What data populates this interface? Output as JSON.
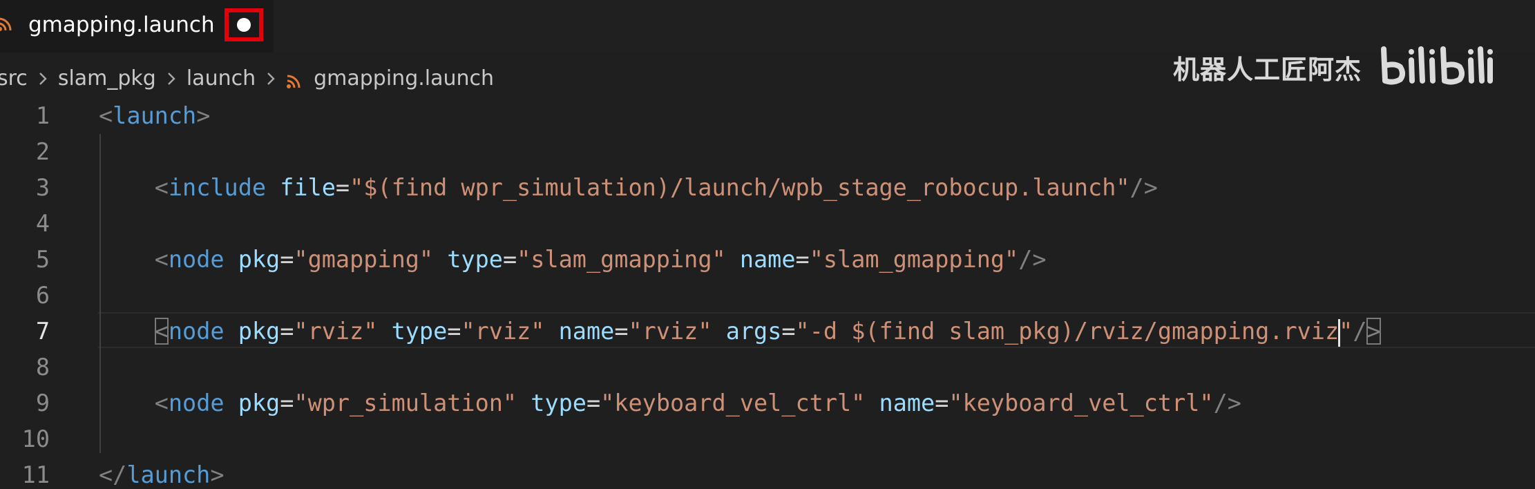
{
  "tab": {
    "title": "gmapping.launch",
    "file_icon": "rss-icon",
    "unsaved_indicator": "dot-icon",
    "highlight_color": "#e3000b"
  },
  "breadcrumb": {
    "items": [
      "src",
      "slam_pkg",
      "launch"
    ],
    "file": "gmapping.launch",
    "separator_icon": "chevron-right-icon"
  },
  "watermark": {
    "author": "机器人工匠阿杰",
    "logo_text": "bilibili"
  },
  "editor": {
    "active_line": 7,
    "lines": [
      {
        "number": "1",
        "tokens": [
          {
            "t": "<",
            "c": "punct"
          },
          {
            "t": "launch",
            "c": "tag"
          },
          {
            "t": ">",
            "c": "punct"
          }
        ]
      },
      {
        "number": "2",
        "tokens": []
      },
      {
        "number": "3",
        "tokens": [
          {
            "t": "    ",
            "c": "eq"
          },
          {
            "t": "<",
            "c": "punct"
          },
          {
            "t": "include",
            "c": "tag"
          },
          {
            "t": " ",
            "c": "eq"
          },
          {
            "t": "file",
            "c": "attr"
          },
          {
            "t": "=",
            "c": "eq"
          },
          {
            "t": "\"$(find wpr_simulation)/launch/wpb_stage_robocup.launch\"",
            "c": "str"
          },
          {
            "t": "/>",
            "c": "punct"
          }
        ]
      },
      {
        "number": "4",
        "tokens": []
      },
      {
        "number": "5",
        "tokens": [
          {
            "t": "    ",
            "c": "eq"
          },
          {
            "t": "<",
            "c": "punct"
          },
          {
            "t": "node",
            "c": "tag"
          },
          {
            "t": " ",
            "c": "eq"
          },
          {
            "t": "pkg",
            "c": "attr"
          },
          {
            "t": "=",
            "c": "eq"
          },
          {
            "t": "\"gmapping\"",
            "c": "str"
          },
          {
            "t": " ",
            "c": "eq"
          },
          {
            "t": "type",
            "c": "attr"
          },
          {
            "t": "=",
            "c": "eq"
          },
          {
            "t": "\"slam_gmapping\"",
            "c": "str"
          },
          {
            "t": " ",
            "c": "eq"
          },
          {
            "t": "name",
            "c": "attr"
          },
          {
            "t": "=",
            "c": "eq"
          },
          {
            "t": "\"slam_gmapping\"",
            "c": "str"
          },
          {
            "t": "/>",
            "c": "punct"
          }
        ]
      },
      {
        "number": "6",
        "tokens": []
      },
      {
        "number": "7",
        "tokens": [
          {
            "t": "    ",
            "c": "eq"
          },
          {
            "t": "<",
            "c": "punct",
            "match": true
          },
          {
            "t": "node",
            "c": "tag"
          },
          {
            "t": " ",
            "c": "eq"
          },
          {
            "t": "pkg",
            "c": "attr"
          },
          {
            "t": "=",
            "c": "eq"
          },
          {
            "t": "\"rviz\"",
            "c": "str"
          },
          {
            "t": " ",
            "c": "eq"
          },
          {
            "t": "type",
            "c": "attr"
          },
          {
            "t": "=",
            "c": "eq"
          },
          {
            "t": "\"rviz\"",
            "c": "str"
          },
          {
            "t": " ",
            "c": "eq"
          },
          {
            "t": "name",
            "c": "attr"
          },
          {
            "t": "=",
            "c": "eq"
          },
          {
            "t": "\"rviz\"",
            "c": "str"
          },
          {
            "t": " ",
            "c": "eq"
          },
          {
            "t": "args",
            "c": "attr"
          },
          {
            "t": "=",
            "c": "eq"
          },
          {
            "t": "\"-d $(find slam_pkg)/rviz/gmapping.rviz",
            "c": "str"
          },
          {
            "t": "",
            "c": "cursor"
          },
          {
            "t": "\"",
            "c": "str"
          },
          {
            "t": "/",
            "c": "punct"
          },
          {
            "t": ">",
            "c": "punct",
            "match": true
          }
        ]
      },
      {
        "number": "8",
        "tokens": []
      },
      {
        "number": "9",
        "tokens": [
          {
            "t": "    ",
            "c": "eq"
          },
          {
            "t": "<",
            "c": "punct"
          },
          {
            "t": "node",
            "c": "tag"
          },
          {
            "t": " ",
            "c": "eq"
          },
          {
            "t": "pkg",
            "c": "attr"
          },
          {
            "t": "=",
            "c": "eq"
          },
          {
            "t": "\"wpr_simulation\"",
            "c": "str"
          },
          {
            "t": " ",
            "c": "eq"
          },
          {
            "t": "type",
            "c": "attr"
          },
          {
            "t": "=",
            "c": "eq"
          },
          {
            "t": "\"keyboard_vel_ctrl\"",
            "c": "str"
          },
          {
            "t": " ",
            "c": "eq"
          },
          {
            "t": "name",
            "c": "attr"
          },
          {
            "t": "=",
            "c": "eq"
          },
          {
            "t": "\"keyboard_vel_ctrl\"",
            "c": "str"
          },
          {
            "t": "/>",
            "c": "punct"
          }
        ]
      },
      {
        "number": "10",
        "tokens": []
      },
      {
        "number": "11",
        "tokens": [
          {
            "t": "</",
            "c": "punct"
          },
          {
            "t": "launch",
            "c": "tag"
          },
          {
            "t": ">",
            "c": "punct"
          }
        ]
      }
    ]
  }
}
